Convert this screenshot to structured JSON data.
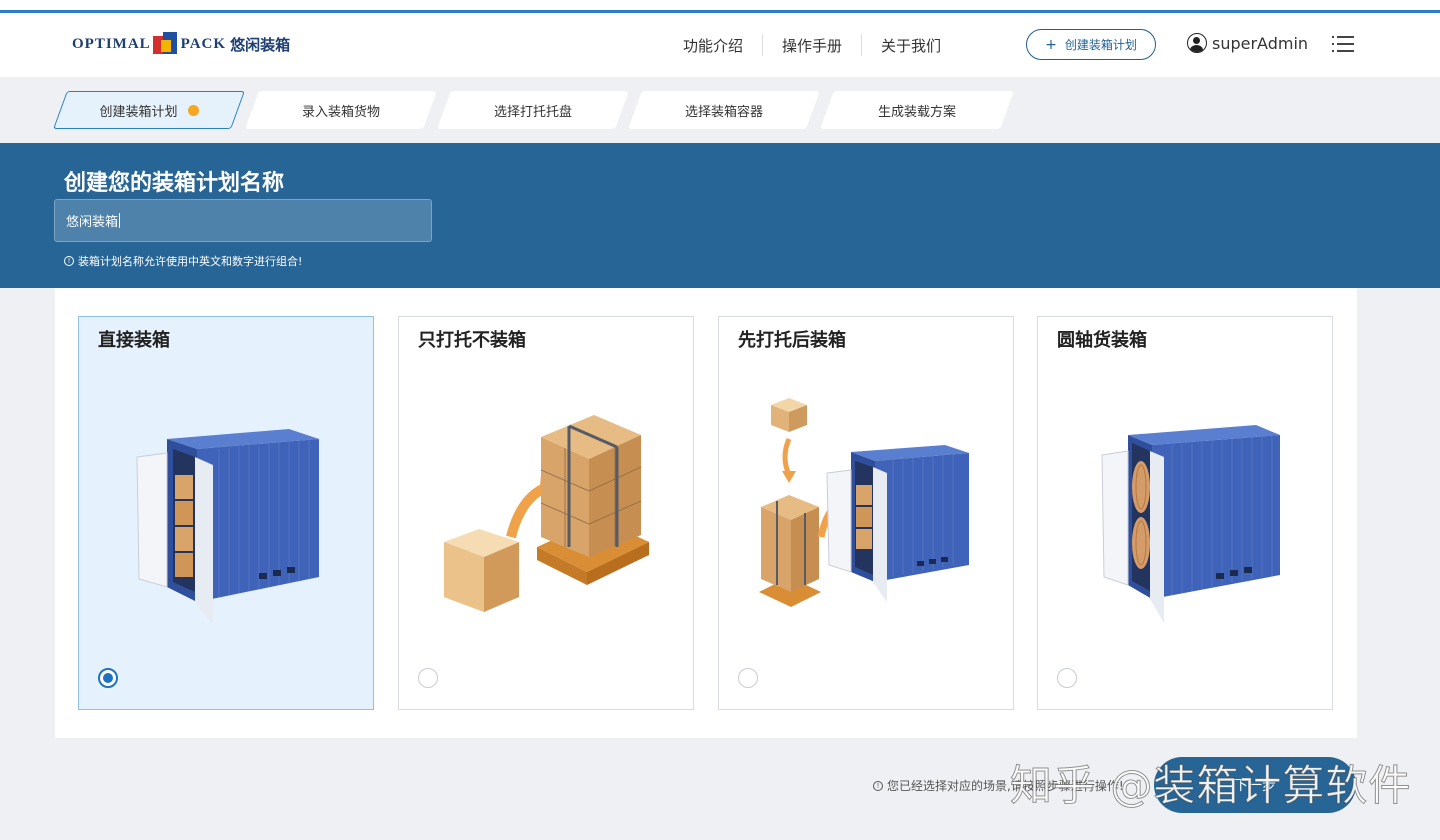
{
  "brand": {
    "logo_left": "OPTIMAL",
    "logo_right": "PACK",
    "logo_cn": "悠闲装箱"
  },
  "nav": {
    "menu": [
      "功能介绍",
      "操作手册",
      "关于我们"
    ],
    "create_plus": "+",
    "create_label": "创建装箱计划",
    "username": "superAdmin"
  },
  "steps": [
    {
      "label": "创建装箱计划",
      "active": true
    },
    {
      "label": "录入装箱货物",
      "active": false
    },
    {
      "label": "选择打托托盘",
      "active": false
    },
    {
      "label": "选择装箱容器",
      "active": false
    },
    {
      "label": "生成装载方案",
      "active": false
    }
  ],
  "banner": {
    "title": "创建您的装箱计划名称",
    "input_value": "悠闲装箱",
    "hint": "装箱计划名称允许使用中英文和数字进行组合!"
  },
  "scenarios": [
    {
      "title": "直接装箱",
      "selected": true
    },
    {
      "title": "只打托不装箱",
      "selected": false
    },
    {
      "title": "先打托后装箱",
      "selected": false
    },
    {
      "title": "圆轴货装箱",
      "selected": false
    }
  ],
  "footer": {
    "hint": "您已经选择对应的场景,请按照步骤进行操作!",
    "next_label": "下一步",
    "watermark": "知乎 @装箱计算软件"
  },
  "colors": {
    "accent": "#266596",
    "active_step_dot": "#f5a623",
    "container_blue": "#3f63b8",
    "box_tan": "#d9a46a"
  }
}
